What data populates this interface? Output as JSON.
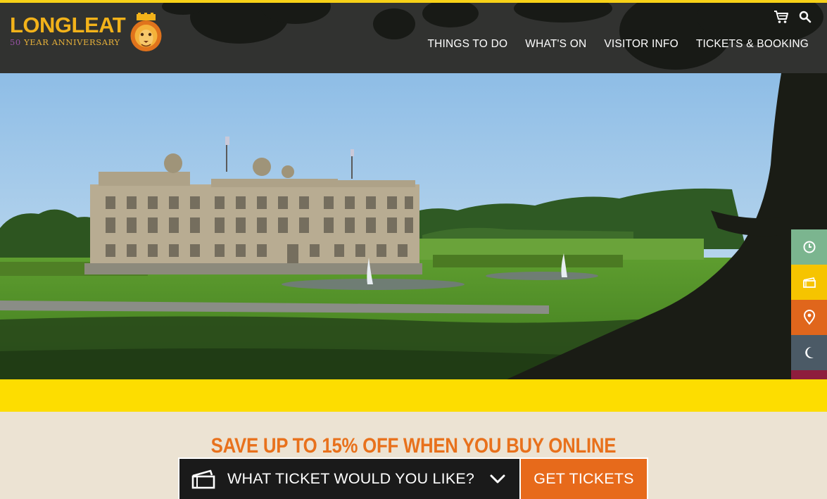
{
  "brand": {
    "name": "LONGLEAT",
    "anniversary_number": "50",
    "anniversary_text": "YEAR ANNIVERSARY",
    "primary_color": "#f2b21a",
    "accent_yellow": "#fddd00",
    "accent_orange": "#e76a1b"
  },
  "utility": {
    "cart_icon": "shopping-cart-icon",
    "search_icon": "search-icon"
  },
  "nav": {
    "items": [
      {
        "label": "THINGS TO DO"
      },
      {
        "label": "WHAT'S ON"
      },
      {
        "label": "VISITOR INFO"
      },
      {
        "label": "TICKETS & BOOKING"
      }
    ]
  },
  "side_tabs": [
    {
      "icon": "clock-icon",
      "color": "#7bb58f"
    },
    {
      "icon": "ticket-icon",
      "color": "#f6c400"
    },
    {
      "icon": "location-pin-icon",
      "color": "#e0661c"
    },
    {
      "icon": "moon-icon",
      "color": "#4b5a66"
    },
    {
      "icon": "share-icon",
      "color": "#8e1d3d"
    }
  ],
  "promo": {
    "title": "SAVE UP TO 15% OFF WHEN YOU BUY ONLINE"
  },
  "booking": {
    "ticket_icon": "ticket-icon",
    "select_label": "WHAT TICKET WOULD YOU LIKE?",
    "chevron_icon": "chevron-down-icon",
    "cta_label": "GET TICKETS"
  }
}
